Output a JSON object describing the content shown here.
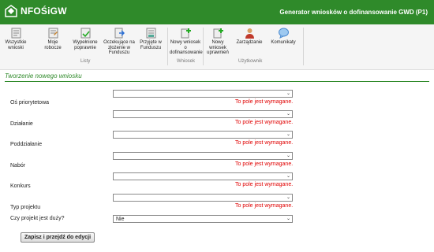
{
  "header": {
    "logo_text": "NFOŚiGW",
    "title": "Generator wniosków o dofinansowanie GWD (P1)"
  },
  "ribbon": {
    "buttons": [
      {
        "label": "Wszystkie wnioski"
      },
      {
        "label": "Moje robocze"
      },
      {
        "label": "Wypełnione poprawnie"
      },
      {
        "label": "Oczekujące na złożenie w Funduszu"
      },
      {
        "label": "Przyjęte w Funduszu"
      },
      {
        "label": "Nowy wniosek o dofinansowanie"
      },
      {
        "label": "Nowy wniosek uprawnień"
      },
      {
        "label": "Zarządzanie"
      },
      {
        "label": "Komunikaty"
      }
    ],
    "groups": {
      "lists": "Listy",
      "request": "Wniosek",
      "user": "Użytkownik"
    }
  },
  "section_title": "Tworzenie nowego wniosku",
  "form": {
    "required_msg": "To pole jest wymagane.",
    "fields": [
      {
        "label": "Oś priorytetowa",
        "value": ""
      },
      {
        "label": "Działanie",
        "value": ""
      },
      {
        "label": "Poddziałanie",
        "value": ""
      },
      {
        "label": "Nabór",
        "value": ""
      },
      {
        "label": "Konkurs",
        "value": ""
      },
      {
        "label": "Typ projektu",
        "value": ""
      },
      {
        "label": "Czy projekt jest duży?",
        "value": "Nie"
      }
    ],
    "submit_label": "Zapisz i przejdź do edycji"
  },
  "colors": {
    "brand": "#2f8a2a",
    "error": "#e00000"
  }
}
